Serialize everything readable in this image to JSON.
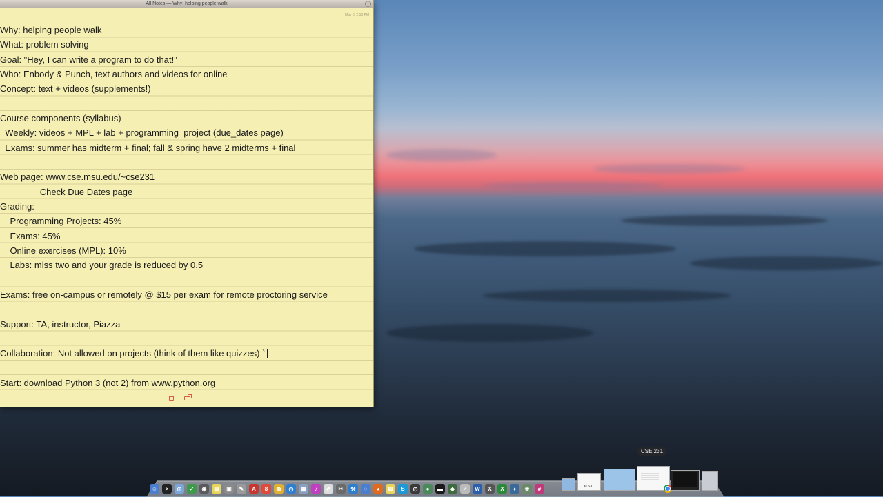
{
  "window": {
    "title": "All Notes — Why: helping people walk",
    "date": "May 8, 2:53 PM"
  },
  "note": {
    "lines": [
      "Why: helping people walk",
      "What: problem solving",
      "Goal: \"Hey, I can write a program to do that!\"",
      "Who: Enbody & Punch, text authors and videos for online",
      "Concept: text + videos (supplements!)",
      "",
      "Course components (syllabus)",
      "  Weekly: videos + MPL + lab + programming  project (due_dates page)",
      "  Exams: summer has midterm + final; fall & spring have 2 midterms + final",
      "",
      "Web page: www.cse.msu.edu/~cse231",
      "                Check Due Dates page",
      "Grading:",
      "    Programming Projects: 45%",
      "    Exams: 45%",
      "    Online exercises (MPL): 10%",
      "    Labs: miss two and your grade is reduced by 0.5",
      "",
      "Exams: free on-campus or remotely @ $15 per exam for remote proctoring service",
      "",
      "Support: TA, instructor, Piazza",
      "",
      "Collaboration: Not allowed on projects (think of them like quizzes) `",
      "",
      "Start: download Python 3 (not 2) from www.python.org"
    ],
    "cursor_line": 22
  },
  "dock": {
    "tooltip": "CSE 231",
    "apps": [
      {
        "name": "finder-icon",
        "color": "#4a7fd0",
        "glyph": "☺"
      },
      {
        "name": "terminal-icon",
        "color": "#222222",
        "glyph": ">"
      },
      {
        "name": "safari-icon",
        "color": "#7aa6d8",
        "glyph": "◎"
      },
      {
        "name": "maps-icon",
        "color": "#3c9a4a",
        "glyph": "✓"
      },
      {
        "name": "dashboard-icon",
        "color": "#5a5a5a",
        "glyph": "◉"
      },
      {
        "name": "stickies-icon",
        "color": "#e8d55a",
        "glyph": "▤"
      },
      {
        "name": "preview-icon",
        "color": "#8a8a8a",
        "glyph": "▣"
      },
      {
        "name": "scripts-icon",
        "color": "#9a9a9a",
        "glyph": "✎"
      },
      {
        "name": "acrobat-icon",
        "color": "#c8362f",
        "glyph": "A"
      },
      {
        "name": "calendar-icon",
        "color": "#e04a3a",
        "glyph": "8"
      },
      {
        "name": "chrome-icon",
        "color": "#e0b030",
        "glyph": "◍"
      },
      {
        "name": "app-store-icon",
        "color": "#2f7fd0",
        "glyph": "◷"
      },
      {
        "name": "photo-icon",
        "color": "#8aa0c0",
        "glyph": "▦"
      },
      {
        "name": "itunes-icon",
        "color": "#c040c0",
        "glyph": "♪"
      },
      {
        "name": "textedit-icon",
        "color": "#dddddd",
        "glyph": "✐"
      },
      {
        "name": "tools-icon",
        "color": "#6a6a6a",
        "glyph": "✂"
      },
      {
        "name": "xcode-icon",
        "color": "#2f7fd0",
        "glyph": "⚒"
      },
      {
        "name": "network-icon",
        "color": "#4a7fd0",
        "glyph": "◌"
      },
      {
        "name": "firefox-icon",
        "color": "#e06a20",
        "glyph": "◕"
      },
      {
        "name": "notes-icon",
        "color": "#e8d55a",
        "glyph": "▤"
      },
      {
        "name": "skype-icon",
        "color": "#1a9ad8",
        "glyph": "S"
      },
      {
        "name": "time-machine-icon",
        "color": "#3a3a3a",
        "glyph": "◴"
      },
      {
        "name": "camera-icon",
        "color": "#4a8a5a",
        "glyph": "●"
      },
      {
        "name": "console-icon",
        "color": "#1a1a1a",
        "glyph": "▬"
      },
      {
        "name": "python-icon",
        "color": "#3d6b3d",
        "glyph": "◆"
      },
      {
        "name": "reminders-icon",
        "color": "#bbbbbb",
        "glyph": "✓"
      },
      {
        "name": "word-icon",
        "color": "#2a5fb0",
        "glyph": "W"
      },
      {
        "name": "x11-icon",
        "color": "#555555",
        "glyph": "X"
      },
      {
        "name": "excel-icon",
        "color": "#2a8a3a",
        "glyph": "X"
      },
      {
        "name": "vpn-icon",
        "color": "#3a6a9a",
        "glyph": "♦"
      },
      {
        "name": "growl-icon",
        "color": "#6a8a6a",
        "glyph": "❀"
      },
      {
        "name": "slack-icon",
        "color": "#c03a7a",
        "glyph": "#"
      }
    ],
    "documents": [
      {
        "name": "folder-icon",
        "label": ""
      },
      {
        "name": "xlsx-doc-icon",
        "label": "XLSX"
      },
      {
        "name": "folder-stack-icon",
        "label": ""
      },
      {
        "name": "cse231-doc-icon",
        "label": ""
      },
      {
        "name": "terminal-window-icon",
        "label": ""
      },
      {
        "name": "trash-icon",
        "label": ""
      }
    ]
  }
}
